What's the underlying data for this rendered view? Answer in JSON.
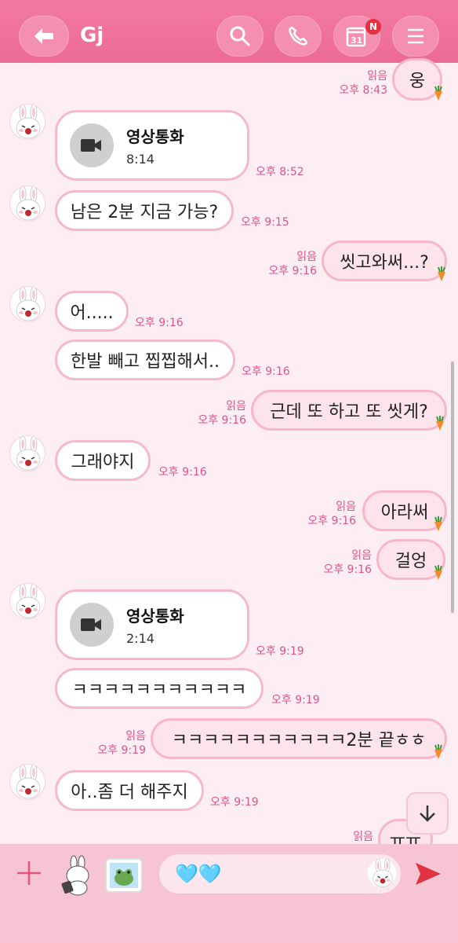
{
  "header": {
    "title": "Gj",
    "badge": "N"
  },
  "messages": [
    {
      "side": "right",
      "text": "웅",
      "read": "읽음",
      "time": "오후 8:43"
    },
    {
      "side": "left",
      "type": "video",
      "title": "영상통화",
      "duration": "8:14",
      "time": "오후 8:52"
    },
    {
      "side": "left",
      "text": "남은 2분 지금 가능?",
      "time": "오후 9:15"
    },
    {
      "side": "right",
      "text": "씻고와써...?",
      "read": "읽음",
      "time": "오후 9:16"
    },
    {
      "side": "left",
      "text": "어.....",
      "time": "오후 9:16"
    },
    {
      "side": "left",
      "text": "한발 빼고 찝찝해서..",
      "time": "오후 9:16"
    },
    {
      "side": "right",
      "text": "근데 또 하고 또 씻게?",
      "read": "읽음",
      "time": "오후 9:16"
    },
    {
      "side": "left",
      "text": "그래야지",
      "time": "오후 9:16"
    },
    {
      "side": "right",
      "text": "아라써",
      "read": "읽음",
      "time": "오후 9:16"
    },
    {
      "side": "right",
      "text": "걸엉",
      "read": "읽음",
      "time": "오후 9:16"
    },
    {
      "side": "left",
      "type": "video",
      "title": "영상통화",
      "duration": "2:14",
      "time": "오후 9:19"
    },
    {
      "side": "left",
      "text": "ㅋㅋㅋㅋㅋㅋㅋㅋㅋㅋㅋ",
      "time": "오후 9:19"
    },
    {
      "side": "right",
      "text": "ㅋㅋㅋㅋㅋㅋㅋㅋㅋㅋㅋ2분 끝ㅎㅎ",
      "read": "읽음",
      "time": "오후 9:19"
    },
    {
      "side": "left",
      "text": "아..좀 더 해주지",
      "time": "오후 9:19"
    },
    {
      "side": "right",
      "text": "ㅠㅠ",
      "read": "읽음"
    }
  ],
  "input": {
    "text": "🩵🩵"
  },
  "colors": {
    "header": "#ec6b95",
    "background": "#fdeef3",
    "accent": "#d9568b",
    "send": "#e0323f"
  }
}
